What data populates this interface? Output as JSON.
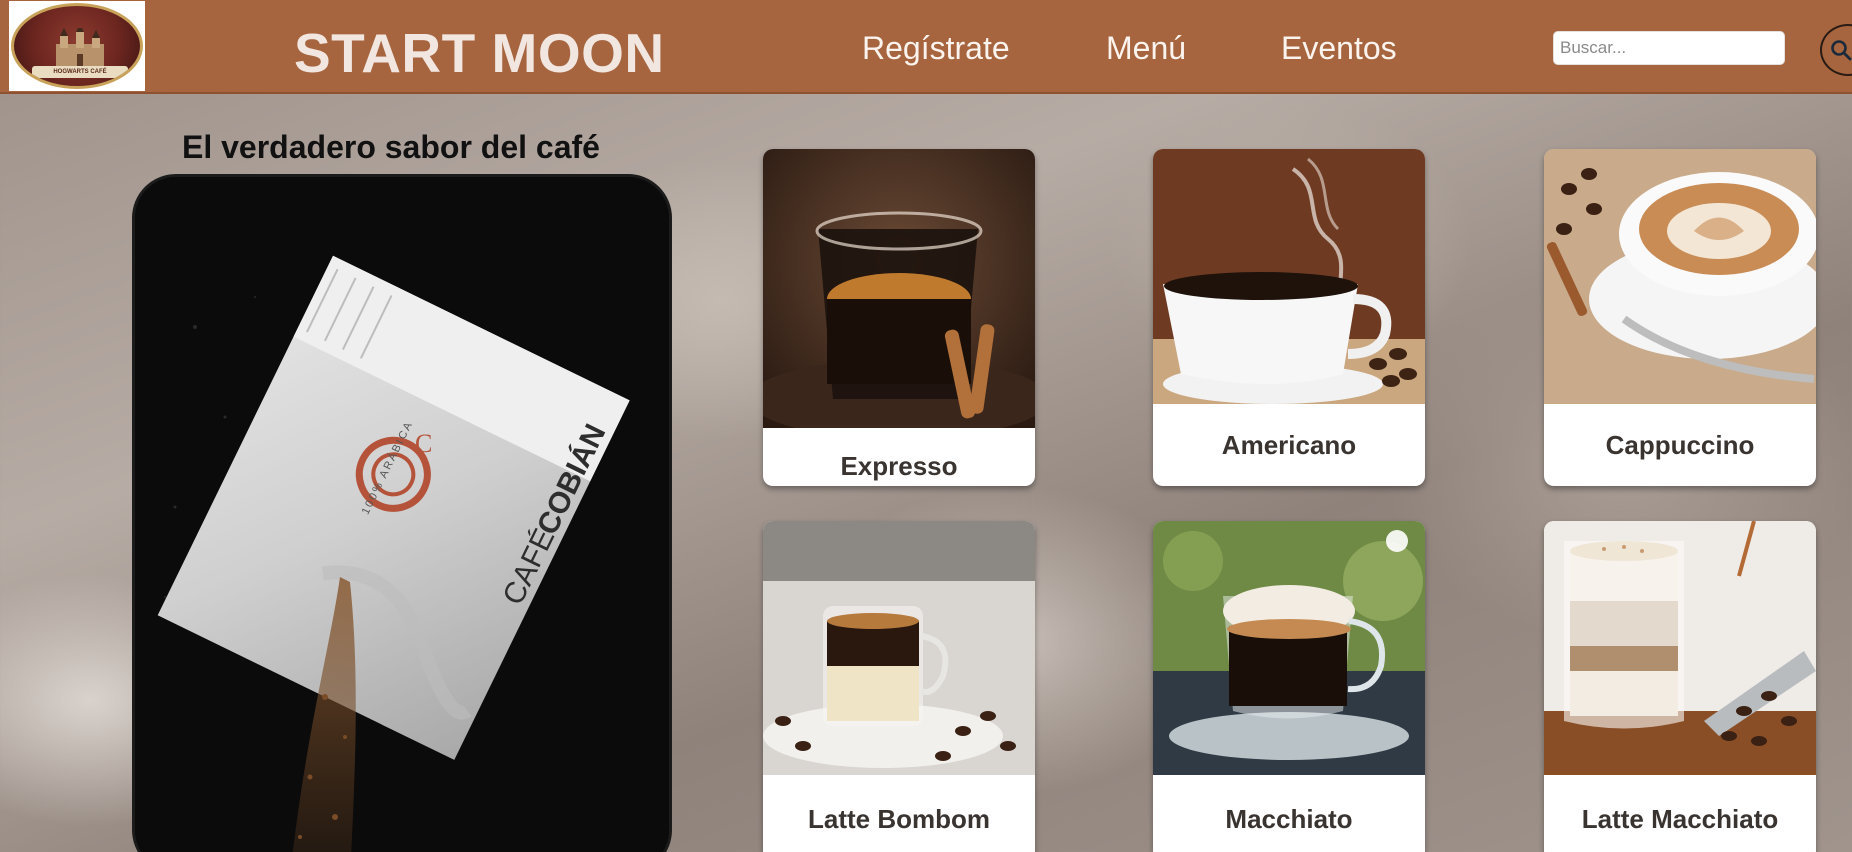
{
  "header": {
    "logo_text": "HOGWARTS CAFÉ",
    "brand": "START MOON",
    "nav": [
      {
        "label": "Regístrate"
      },
      {
        "label": "Menú"
      },
      {
        "label": "Eventos"
      }
    ],
    "search": {
      "placeholder": "Buscar...",
      "value": ""
    },
    "search_icon": "search-icon"
  },
  "promo": {
    "title": "El verdadero sabor del café",
    "bag_text": {
      "tag": "100% ARÁBICA",
      "brand_prefix": "CAFÉ",
      "brand_name": "COBIÁN",
      "mark": "C"
    }
  },
  "products": [
    {
      "name": "Expresso"
    },
    {
      "name": "Americano"
    },
    {
      "name": "Cappuccino"
    },
    {
      "name": "Latte Bombom"
    },
    {
      "name": "Macchiato"
    },
    {
      "name": "Latte Macchiato"
    }
  ],
  "colors": {
    "header_bg": "#a6653e",
    "brand_text": "#f2e6e1",
    "nav_text": "#fbf3ee",
    "card_bg": "#ffffff",
    "card_label": "#3a3431"
  }
}
